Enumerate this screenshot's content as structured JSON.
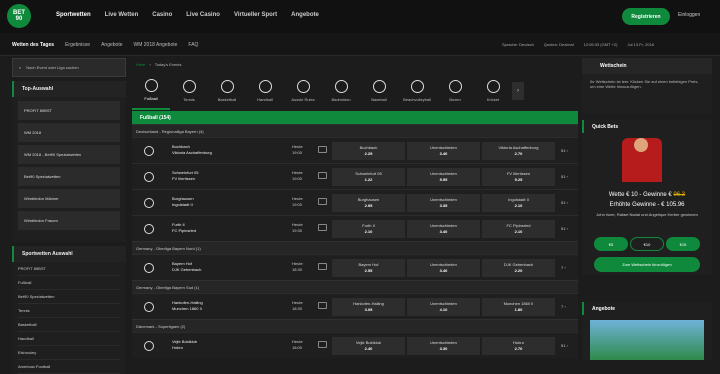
{
  "brand": {
    "logo_top": "BET",
    "logo_bottom": "90",
    "accent": "#0f8a3c"
  },
  "nav": {
    "items": [
      "Sportwetten",
      "Live Wetten",
      "Casino",
      "Live Casino",
      "Virtueller Sport",
      "Angebote"
    ],
    "register": "Registrieren",
    "login": "Einloggen"
  },
  "subnav": {
    "items": [
      "Wetten des Tages",
      "Ergebnisse",
      "Angebote",
      "WM 2018 Angebote",
      "FAQ"
    ]
  },
  "settings": {
    "language": "Sprache: Deutsch",
    "odds": "Quoten: Dezimal",
    "time": "12:05:33 (GMT +2)",
    "date": "Jul 13 Fr, 2018"
  },
  "left": {
    "search_placeholder": "Nach Event oder Liga suchen",
    "top_title": "Top-Auswahl",
    "top_items": [
      "PROFIT 89BST",
      "WM 2018",
      "WM 2018 - Bet90 Spezialwetten",
      "Bet90 Spezialwetten",
      "Wimbledon Männer",
      "Wimbledon Frauen"
    ],
    "sports_title": "Sportwetten Auswahl",
    "sports_items": [
      "PROFIT 89BST",
      "Fußball",
      "Bet90 Spezialwetten",
      "Tennis",
      "Basketball",
      "Handball",
      "Eishockey",
      "American Football"
    ]
  },
  "center": {
    "breadcrumb_home": "Heim",
    "breadcrumb_current": "Today's Events",
    "sports": [
      "Fußball",
      "Tennis",
      "Basketball",
      "Handball",
      "Aussie Rules",
      "Badminton",
      "Baseball",
      "Beachvolleyball",
      "Boxen",
      "Kricket"
    ],
    "active_title": "Fußball (154)",
    "leagues": [
      {
        "name": "Deutschland - Regionalliga Bayern (4)",
        "events": [
          {
            "home": "Buchbach",
            "away": "Viktoria Aschaffenburg",
            "day": "Heute",
            "time": "19:00",
            "o1": "Buchbach",
            "v1": "2.25",
            "ox": "Unentschieden",
            "vx": "3.40",
            "o2": "Viktoria Aschaffenburg",
            "v2": "2.70",
            "more": "51 ›"
          },
          {
            "home": "Schweinfurt 05",
            "away": "FV Illertissen",
            "day": "Heute",
            "time": "19:00",
            "o1": "Schweinfurt 05",
            "v1": "1.22",
            "ox": "Unentschieden",
            "vx": "5.95",
            "o2": "FV Illertissen",
            "v2": "9.25",
            "more": "51 ›"
          },
          {
            "home": "Burghausen",
            "away": "Ingolstadt II",
            "day": "Heute",
            "time": "19:00",
            "o1": "Burghausen",
            "v1": "2.95",
            "ox": "Unentschieden",
            "vx": "3.35",
            "o2": "Ingolstadt II",
            "v2": "2.10",
            "more": "51 ›"
          },
          {
            "home": "Furth II",
            "away": "FC Pipinsried",
            "day": "Heute",
            "time": "19:30",
            "o1": "Furth II",
            "v1": "2.10",
            "ox": "Unentschieden",
            "vx": "3.40",
            "o2": "FC Pipinsried",
            "v2": "2.10",
            "more": "51 ›"
          }
        ]
      },
      {
        "name": "Germany - Oberliga Bayern Nord (1)",
        "events": [
          {
            "home": "Bayern Hof",
            "away": "DJK Gebenbach",
            "day": "Heute",
            "time": "18:30",
            "o1": "Bayern Hof",
            "v1": "2.55",
            "ox": "Unentschieden",
            "vx": "3.40",
            "o2": "DJK Gebenbach",
            "v2": "2.20",
            "more": "7 ›"
          }
        ]
      },
      {
        "name": "Germany - Oberliga Bayern Sud (1)",
        "events": [
          {
            "home": "Hankofen-Hailing",
            "away": "Munchen 1860 II",
            "day": "Heute",
            "time": "18:30",
            "o1": "Hankofen-Hailing",
            "v1": "3.05",
            "ox": "Unentschieden",
            "vx": "4.10",
            "o2": "Munchen 1860 II",
            "v2": "1.80",
            "more": "7 ›"
          }
        ]
      },
      {
        "name": "Dänemark - Superligaen (2)",
        "events": [
          {
            "home": "Vejle Boldklub",
            "away": "Hobro",
            "day": "Heute",
            "time": "18:00",
            "o1": "Vejle Boldklub",
            "v1": "2.40",
            "ox": "Unentschieden",
            "vx": "3.30",
            "o2": "Hobro",
            "v2": "2.70",
            "more": "51 ›"
          }
        ]
      }
    ]
  },
  "right": {
    "betslip_title": "Wettschein",
    "betslip_text": "Ihr Wettschein ist leer. Klicken Sie auf einen beliebigen Preis, um eine Wette hinzuzufügen.",
    "quick_title": "Quick Bets",
    "bet_line": "Wette € 10 - Gewinne €",
    "bet_old": "96.3",
    "bet_new": "Erhöhte Gewinne - € 105.96",
    "players": "John Isner, Rafael Nadal und Angelique Kerber gewinnen",
    "stakes": [
      "€5",
      "€10",
      "€15"
    ],
    "add_button": "Zum Wettschein hinzufügen",
    "angebote_title": "Angebote"
  }
}
